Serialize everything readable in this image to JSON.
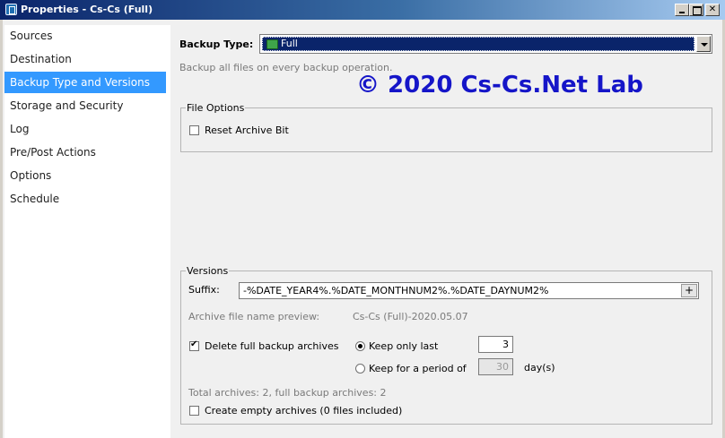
{
  "window": {
    "title": "Properties - Cs-Cs (Full)",
    "controls": {
      "minimize": "_",
      "maximize": "□",
      "close": "✕"
    }
  },
  "sidebar": {
    "items": [
      {
        "label": "Sources"
      },
      {
        "label": "Destination"
      },
      {
        "label": "Backup Type and Versions",
        "selected": true
      },
      {
        "label": "Storage and Security"
      },
      {
        "label": "Log"
      },
      {
        "label": "Pre/Post Actions"
      },
      {
        "label": "Options"
      },
      {
        "label": "Schedule"
      }
    ]
  },
  "main": {
    "backup_type_label": "Backup Type:",
    "backup_type_value": "Full",
    "backup_type_icon": "book-icon",
    "backup_type_hint": "Backup all files on every backup operation.",
    "watermark": "© 2020 Cs-Cs.Net Lab",
    "file_options": {
      "legend": "File Options",
      "reset_archive_bit_label": "Reset Archive Bit",
      "reset_archive_bit_checked": false
    },
    "versions": {
      "legend": "Versions",
      "suffix_label": "Suffix:",
      "suffix_value": "-%DATE_YEAR4%.%DATE_MONTHNUM2%.%DATE_DAYNUM2%",
      "suffix_add": "+",
      "preview_label": "Archive file name preview:",
      "preview_value": "Cs-Cs (Full)-2020.05.07",
      "delete_full_label": "Delete full backup archives",
      "delete_full_checked": true,
      "keep_only_last_label": "Keep only last",
      "keep_only_last_selected": true,
      "keep_only_last_value": "3",
      "keep_period_label": "Keep for a period of",
      "keep_period_selected": false,
      "keep_period_value": "30",
      "keep_period_unit": "day(s)",
      "totals": "Total archives: 2, full backup archives: 2",
      "create_empty_label": "Create empty archives (0 files included)",
      "create_empty_checked": false
    }
  },
  "colors": {
    "title_bar": "#0a246a",
    "selection": "#3399ff",
    "watermark": "#1515c8"
  }
}
